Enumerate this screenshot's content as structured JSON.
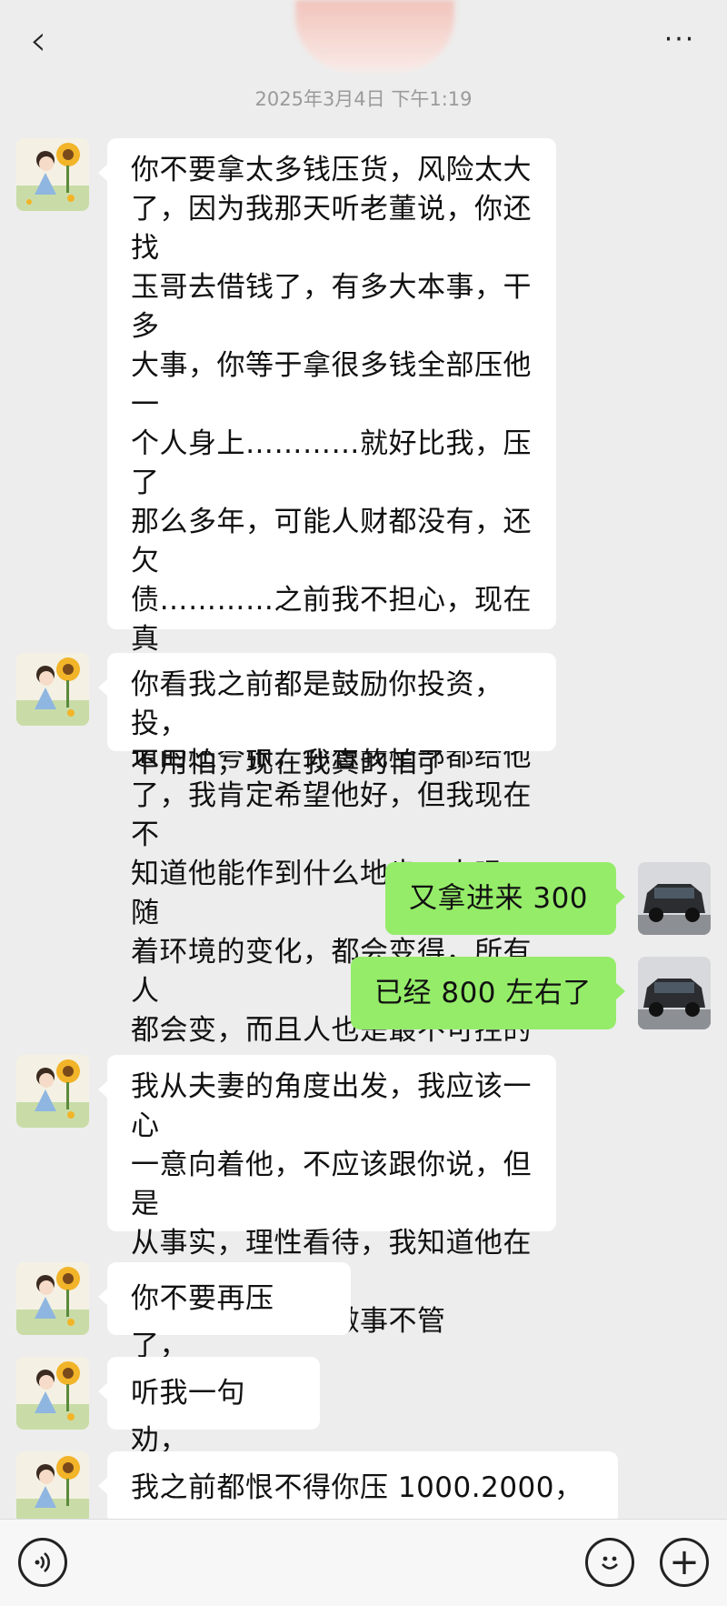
{
  "header": {
    "back_icon": "chevron-left-icon",
    "more_icon": "more-dots-icon",
    "more_label": "···",
    "back_label": "‹"
  },
  "timestamp": "2025年3月4日 下午1:19",
  "messages": [
    {
      "side": "left",
      "text": "你不要拿太多钱压货，风险太大\n了，因为我那天听老董说，你还找\n玉哥去借钱了，有多大本事，干多\n大事，你等于拿很多钱全部压他一\n个人身上…………就好比我，压了\n那么多年，可能人财都没有，还欠\n债…………之前我不担心，现在真\n的说不准………我了解到的比你知\n道的还夸张，你想我全部都给他\n了，我肯定希望他好，但我现在不\n知道他能作到什么地步，人吗，随\n着环境的变化，都会变得，所有人\n都会变，而且人也是最不可控的"
    },
    {
      "side": "left",
      "text": "你看我之前都是鼓励你投资，投，\n不用怕，现在我真的怕了"
    },
    {
      "side": "right",
      "text": "又拿进来 300"
    },
    {
      "side": "right",
      "text": "已经 800 左右了"
    },
    {
      "side": "left",
      "text": "我从夫妻的角度出发，我应该一心\n一意向着他，不应该跟你说，但是\n从事实，理性看待，我知道他在犯\n错了，我就不能做事不管"
    },
    {
      "side": "left",
      "text": "你不要再压了，"
    },
    {
      "side": "left",
      "text": "听我一句劝，"
    },
    {
      "side": "left",
      "text": "我之前都恨不得你压 1000.2000，"
    }
  ],
  "bottom_bar": {
    "voice_icon": "voice-icon",
    "emoji_icon": "emoji-icon",
    "plus_icon": "plus-icon",
    "plus_label": "+"
  },
  "colors": {
    "background": "#ededed",
    "bubble_left": "#ffffff",
    "bubble_right": "#95ec69"
  }
}
